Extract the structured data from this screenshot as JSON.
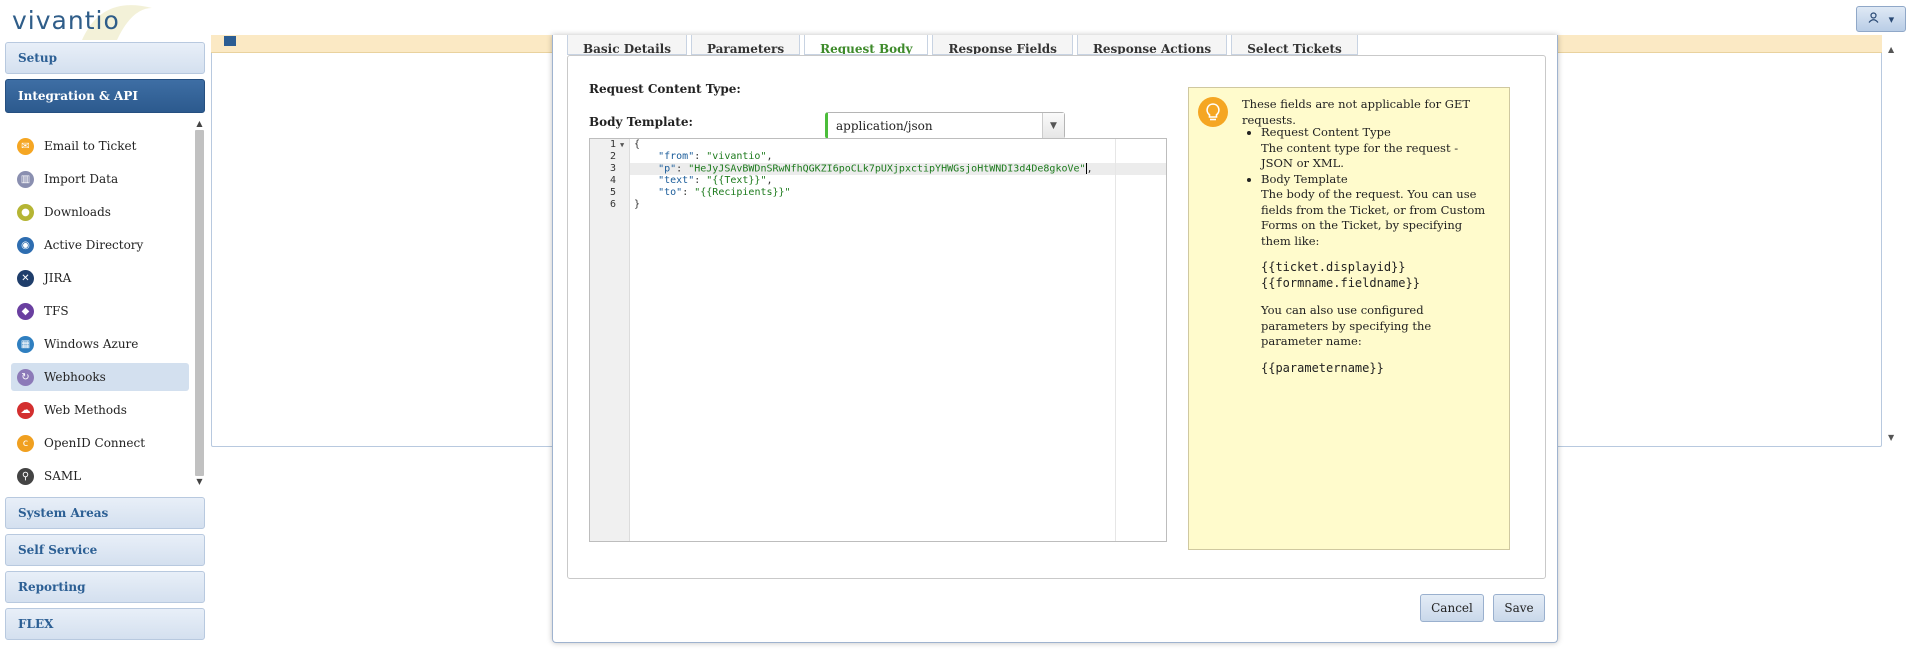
{
  "header": {
    "logo_text": "vivantio",
    "user_icon": "user-icon",
    "user_caret": "▾"
  },
  "sidebar": {
    "top_sections": [
      {
        "label": "Setup"
      },
      {
        "label": "Integration & API"
      }
    ],
    "items": [
      {
        "label": "Email to Ticket",
        "icon": "email-ticket-icon",
        "color": "#f5a623",
        "glyph": "✉"
      },
      {
        "label": "Import Data",
        "icon": "import-data-icon",
        "color": "#8a8fb0",
        "glyph": "▥"
      },
      {
        "label": "Downloads",
        "icon": "downloads-icon",
        "color": "#b5b534",
        "glyph": "●"
      },
      {
        "label": "Active Directory",
        "icon": "active-directory-icon",
        "color": "#2e6db0",
        "glyph": "◉"
      },
      {
        "label": "JIRA",
        "icon": "jira-icon",
        "color": "#1f3e6b",
        "glyph": "✕"
      },
      {
        "label": "TFS",
        "icon": "tfs-icon",
        "color": "#6a3fa0",
        "glyph": "◆"
      },
      {
        "label": "Windows Azure",
        "icon": "windows-azure-icon",
        "color": "#2f7fc0",
        "glyph": "▦"
      },
      {
        "label": "Webhooks",
        "icon": "webhooks-icon",
        "color": "#8c7ab8",
        "glyph": "↻"
      },
      {
        "label": "Web Methods",
        "icon": "web-methods-icon",
        "color": "#d32f2f",
        "glyph": "☁"
      },
      {
        "label": "OpenID Connect",
        "icon": "openid-icon",
        "color": "#f0a020",
        "glyph": "ⅽ"
      },
      {
        "label": "SAML",
        "icon": "saml-icon",
        "color": "#444444",
        "glyph": "⚲"
      }
    ],
    "selected_index": 7,
    "bottom_sections": [
      {
        "label": "System Areas"
      },
      {
        "label": "Self Service"
      },
      {
        "label": "Reporting"
      },
      {
        "label": "FLEX"
      }
    ]
  },
  "modal": {
    "tabs": [
      "Basic Details",
      "Parameters",
      "Request Body",
      "Response Fields",
      "Response Actions",
      "Select Tickets"
    ],
    "active_tab_index": 2,
    "content_type_label": "Request Content Type:",
    "content_type_value": "application/json",
    "body_template_label": "Body Template:",
    "editor": {
      "line_numbers": [
        "1",
        "2",
        "3",
        "4",
        "5",
        "6"
      ],
      "lines": [
        {
          "indent": "",
          "key": "",
          "text": "{"
        },
        {
          "indent": "    ",
          "key": "\"from\"",
          "sep": ": ",
          "value": "\"vivantio\"",
          "tail": ","
        },
        {
          "indent": "    ",
          "key": "\"p\"",
          "sep": ": ",
          "value": "\"HeJyJSAvBWDnSRwNfhQGKZI6poCLk7pUXjpxctipYHWGsjoHtWNDI3d4De8gkoVe\"",
          "tail": ","
        },
        {
          "indent": "    ",
          "key": "\"text\"",
          "sep": ": ",
          "value": "\"{{Text}}\"",
          "tail": ","
        },
        {
          "indent": "    ",
          "key": "\"to\"",
          "sep": ": ",
          "value": "\"{{Recipients}}\"",
          "tail": ""
        },
        {
          "indent": "",
          "key": "",
          "text": "}"
        }
      ],
      "active_line": 3
    },
    "help": {
      "intro": "These fields are not applicable for GET requests.",
      "item1_title": "Request Content Type",
      "item1_desc": "The content type for the request - JSON or XML.",
      "item2_title": "Body Template",
      "item2_desc": "The body of the request. You can use fields from the Ticket, or from Custom Forms on the Ticket, by specifying them like:",
      "example1": "{{ticket.displayid}}",
      "example2": "{{formname.fieldname}}",
      "params_desc": "You can also use configured parameters by specifying the parameter name:",
      "example3": "{{parametername}}"
    },
    "cancel_label": "Cancel",
    "save_label": "Save"
  }
}
